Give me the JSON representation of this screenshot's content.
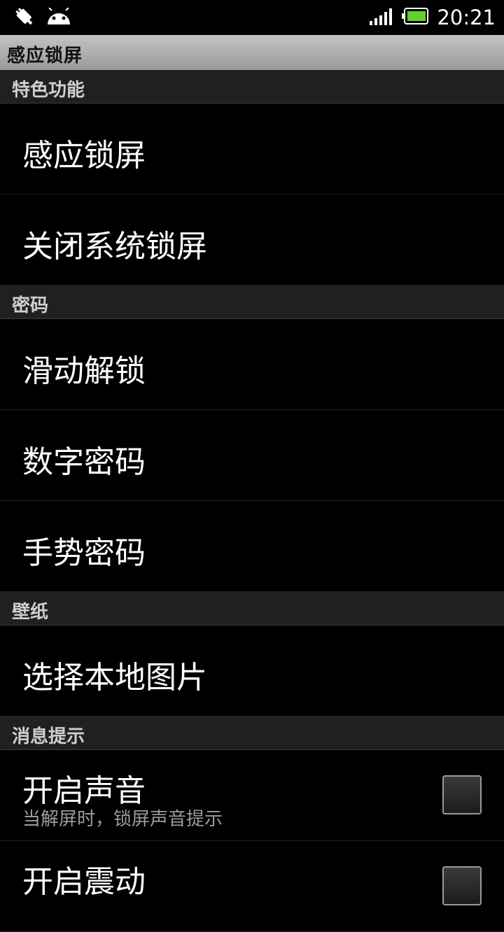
{
  "status_bar": {
    "time": "20:21",
    "icons": [
      "usb-debug-icon",
      "android-icon",
      "signal-icon",
      "battery-icon"
    ]
  },
  "title_bar": {
    "title": "感应锁屏"
  },
  "sections": [
    {
      "header": "特色功能",
      "items": [
        {
          "label": "感应锁屏"
        },
        {
          "label": "关闭系统锁屏"
        }
      ]
    },
    {
      "header": "密码",
      "items": [
        {
          "label": "滑动解锁"
        },
        {
          "label": "数字密码"
        },
        {
          "label": "手势密码"
        }
      ]
    },
    {
      "header": "壁纸",
      "items": [
        {
          "label": "选择本地图片"
        }
      ]
    },
    {
      "header": "消息提示",
      "items": [
        {
          "label": "开启声音",
          "summary": "当解屏时，锁屏声音提示",
          "checked": false
        },
        {
          "label": "开启震动",
          "checked": false
        }
      ]
    }
  ],
  "colors": {
    "battery": "#5fd22a",
    "title_bar": "#b0b0b0",
    "category_bg": "#202020"
  }
}
